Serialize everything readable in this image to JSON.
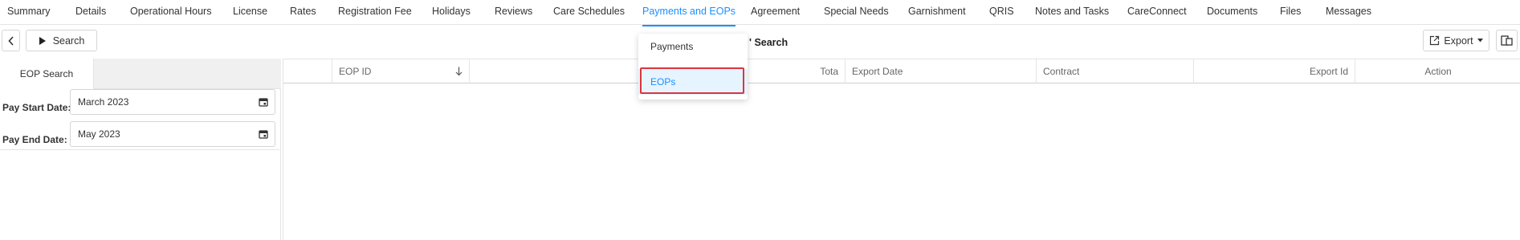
{
  "topnav": {
    "tabs": [
      {
        "label": "Summary",
        "active": false
      },
      {
        "label": "Details",
        "active": false
      },
      {
        "label": "Operational Hours",
        "active": false
      },
      {
        "label": "License",
        "active": false
      },
      {
        "label": "Rates",
        "active": false
      },
      {
        "label": "Registration Fee",
        "active": false
      },
      {
        "label": "Holidays",
        "active": false
      },
      {
        "label": "Reviews",
        "active": false
      },
      {
        "label": "Care Schedules",
        "active": false
      },
      {
        "label": "Payments and EOPs",
        "active": true
      },
      {
        "label": "Agreement",
        "active": false
      },
      {
        "label": "Special Needs",
        "active": false
      },
      {
        "label": "Garnishment",
        "active": false
      },
      {
        "label": "QRIS",
        "active": false
      },
      {
        "label": "Notes and Tasks",
        "active": false
      },
      {
        "label": "CareConnect",
        "active": false
      },
      {
        "label": "Documents",
        "active": false
      },
      {
        "label": "Files",
        "active": false
      },
      {
        "label": "Messages",
        "active": false
      }
    ]
  },
  "toolbar": {
    "search_label": "Search",
    "title_partial": "' Search",
    "export_label": "Export"
  },
  "left_panel": {
    "tab_label": "EOP Search",
    "pay_start_label": "Pay Start Date:",
    "pay_start_value": "March 2023",
    "pay_end_label": "Pay End Date:",
    "pay_end_value": "May 2023"
  },
  "grid": {
    "columns": [
      "EOP ID",
      "Tota",
      "Export Date",
      "Contract",
      "Export Id",
      "Action"
    ]
  },
  "dropdown": {
    "items": [
      {
        "label": "Payments",
        "selected": false
      },
      {
        "label": "EOPs",
        "selected": true
      }
    ]
  },
  "colors": {
    "accent": "#1890ff",
    "highlight": "#d9363e"
  }
}
